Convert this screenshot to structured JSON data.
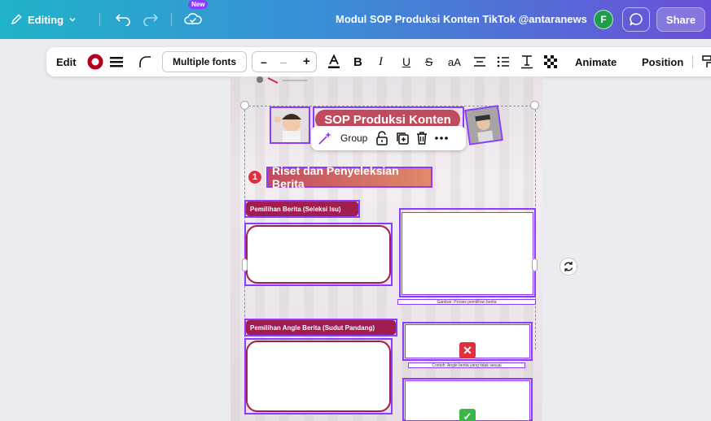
{
  "topbar": {
    "editing_label": "Editing",
    "new_badge": "New",
    "doc_title": "Modul SOP Produksi Konten TikTok @antaranews",
    "avatar_initial": "F",
    "share_label": "Share"
  },
  "toolbar": {
    "edit_label": "Edit",
    "font_label": "Multiple fonts",
    "bold_glyph": "B",
    "italic_glyph": "I",
    "underline_glyph": "U",
    "strike_glyph": "S",
    "case_label": "aA",
    "animate_label": "Animate",
    "position_label": "Position"
  },
  "canvas": {
    "heading": "SOP Produksi Konten",
    "group_label": "Group",
    "section_number": "1",
    "section_title": "Riset dan Penyeleksian Berita",
    "tag1": "Pemilihan Berita (Seleksi Isu)",
    "caption1": "Gambar: Proses pemilihan berita",
    "tag2": "Pemilihan Angle Berita (Sudut Pandang)",
    "caption2": "Contoh: Angle berita yang tidak sesuai",
    "status_wrong": "✕",
    "status_right": "✓"
  },
  "colors": {
    "accent": "#8b3dff",
    "brand_red": "#a01d4e",
    "heading_pill": "#c24a5e"
  }
}
